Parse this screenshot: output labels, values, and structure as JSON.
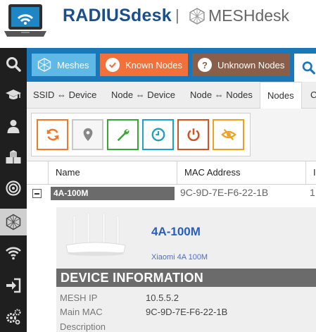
{
  "header": {
    "brand": "RADIUSdesk",
    "separator": "|",
    "mesh_brand": "MESHdesk"
  },
  "sidebar": {
    "items": [
      {
        "icon": "search-icon"
      },
      {
        "icon": "graduation-cap-icon"
      },
      {
        "icon": "user-icon"
      },
      {
        "icon": "cubes-icon"
      },
      {
        "icon": "wifi-target-icon"
      },
      {
        "icon": "mesh-icon",
        "active": true
      },
      {
        "icon": "wifi-icon"
      },
      {
        "icon": "sign-in-icon"
      },
      {
        "icon": "gears-icon"
      }
    ]
  },
  "tabs": {
    "meshes": "Meshes",
    "known_nodes": "Known Nodes",
    "unknown_nodes": "Unknown Nodes"
  },
  "subtabs": {
    "ssid_device": "SSID ⇔ Device",
    "node_device": "Node ⇔ Device",
    "node_nodes": "Node ⇔ Nodes",
    "nodes": "Nodes",
    "more": "C"
  },
  "toolbar": {
    "buttons": [
      {
        "name": "reload",
        "color": "#f07a2a"
      },
      {
        "name": "map",
        "color": "#888888"
      },
      {
        "name": "configure",
        "color": "#3aa535"
      },
      {
        "name": "timing",
        "color": "#1ea1c9"
      },
      {
        "name": "power",
        "color": "#d05522"
      },
      {
        "name": "hide",
        "color": "#f0a020"
      }
    ]
  },
  "grid": {
    "columns": {
      "name": "Name",
      "mac": "MAC Address",
      "extra": "I"
    },
    "row": {
      "name": "4A-100M",
      "mac": "9C-9D-7E-F6-22-1B",
      "extra": "1"
    },
    "detail": {
      "title": "4A-100M",
      "model": "Xiaomi 4A 100M",
      "banner": "DEVICE INFORMATION",
      "fields": [
        {
          "label": "MESH IP",
          "value": "10.5.5.2"
        },
        {
          "label": "Main MAC",
          "value": "9C-9D-7E-F6-22-1B"
        },
        {
          "label": "Description",
          "value": ""
        }
      ]
    }
  },
  "colors": {
    "brand_blue": "#1a4f8c",
    "tabbar": "#1a78b8",
    "tab_meshes": "#5fb9e6",
    "tab_known": "#f2703a",
    "tab_unknown": "#8a5f4a"
  }
}
